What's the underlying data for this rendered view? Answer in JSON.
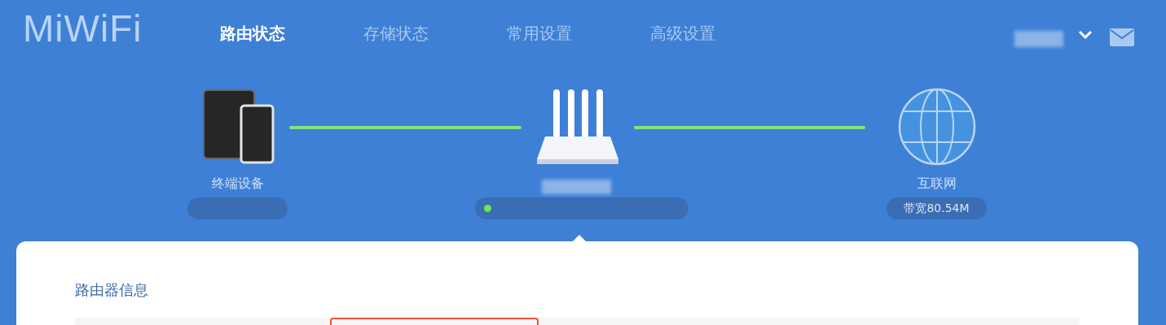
{
  "logo": "MiWiFi",
  "nav": [
    {
      "label": "路由状态",
      "selected": true
    },
    {
      "label": "存储状态",
      "selected": false
    },
    {
      "label": "常用设置",
      "selected": false
    },
    {
      "label": "高级设置",
      "selected": false
    }
  ],
  "topology": {
    "devices": {
      "label": "终端设备"
    },
    "router": {
      "online": true
    },
    "internet": {
      "label": "互联网",
      "bandwidth": "带宽80.54M"
    },
    "links_up": true
  },
  "card": {
    "title": "路由器信息"
  }
}
